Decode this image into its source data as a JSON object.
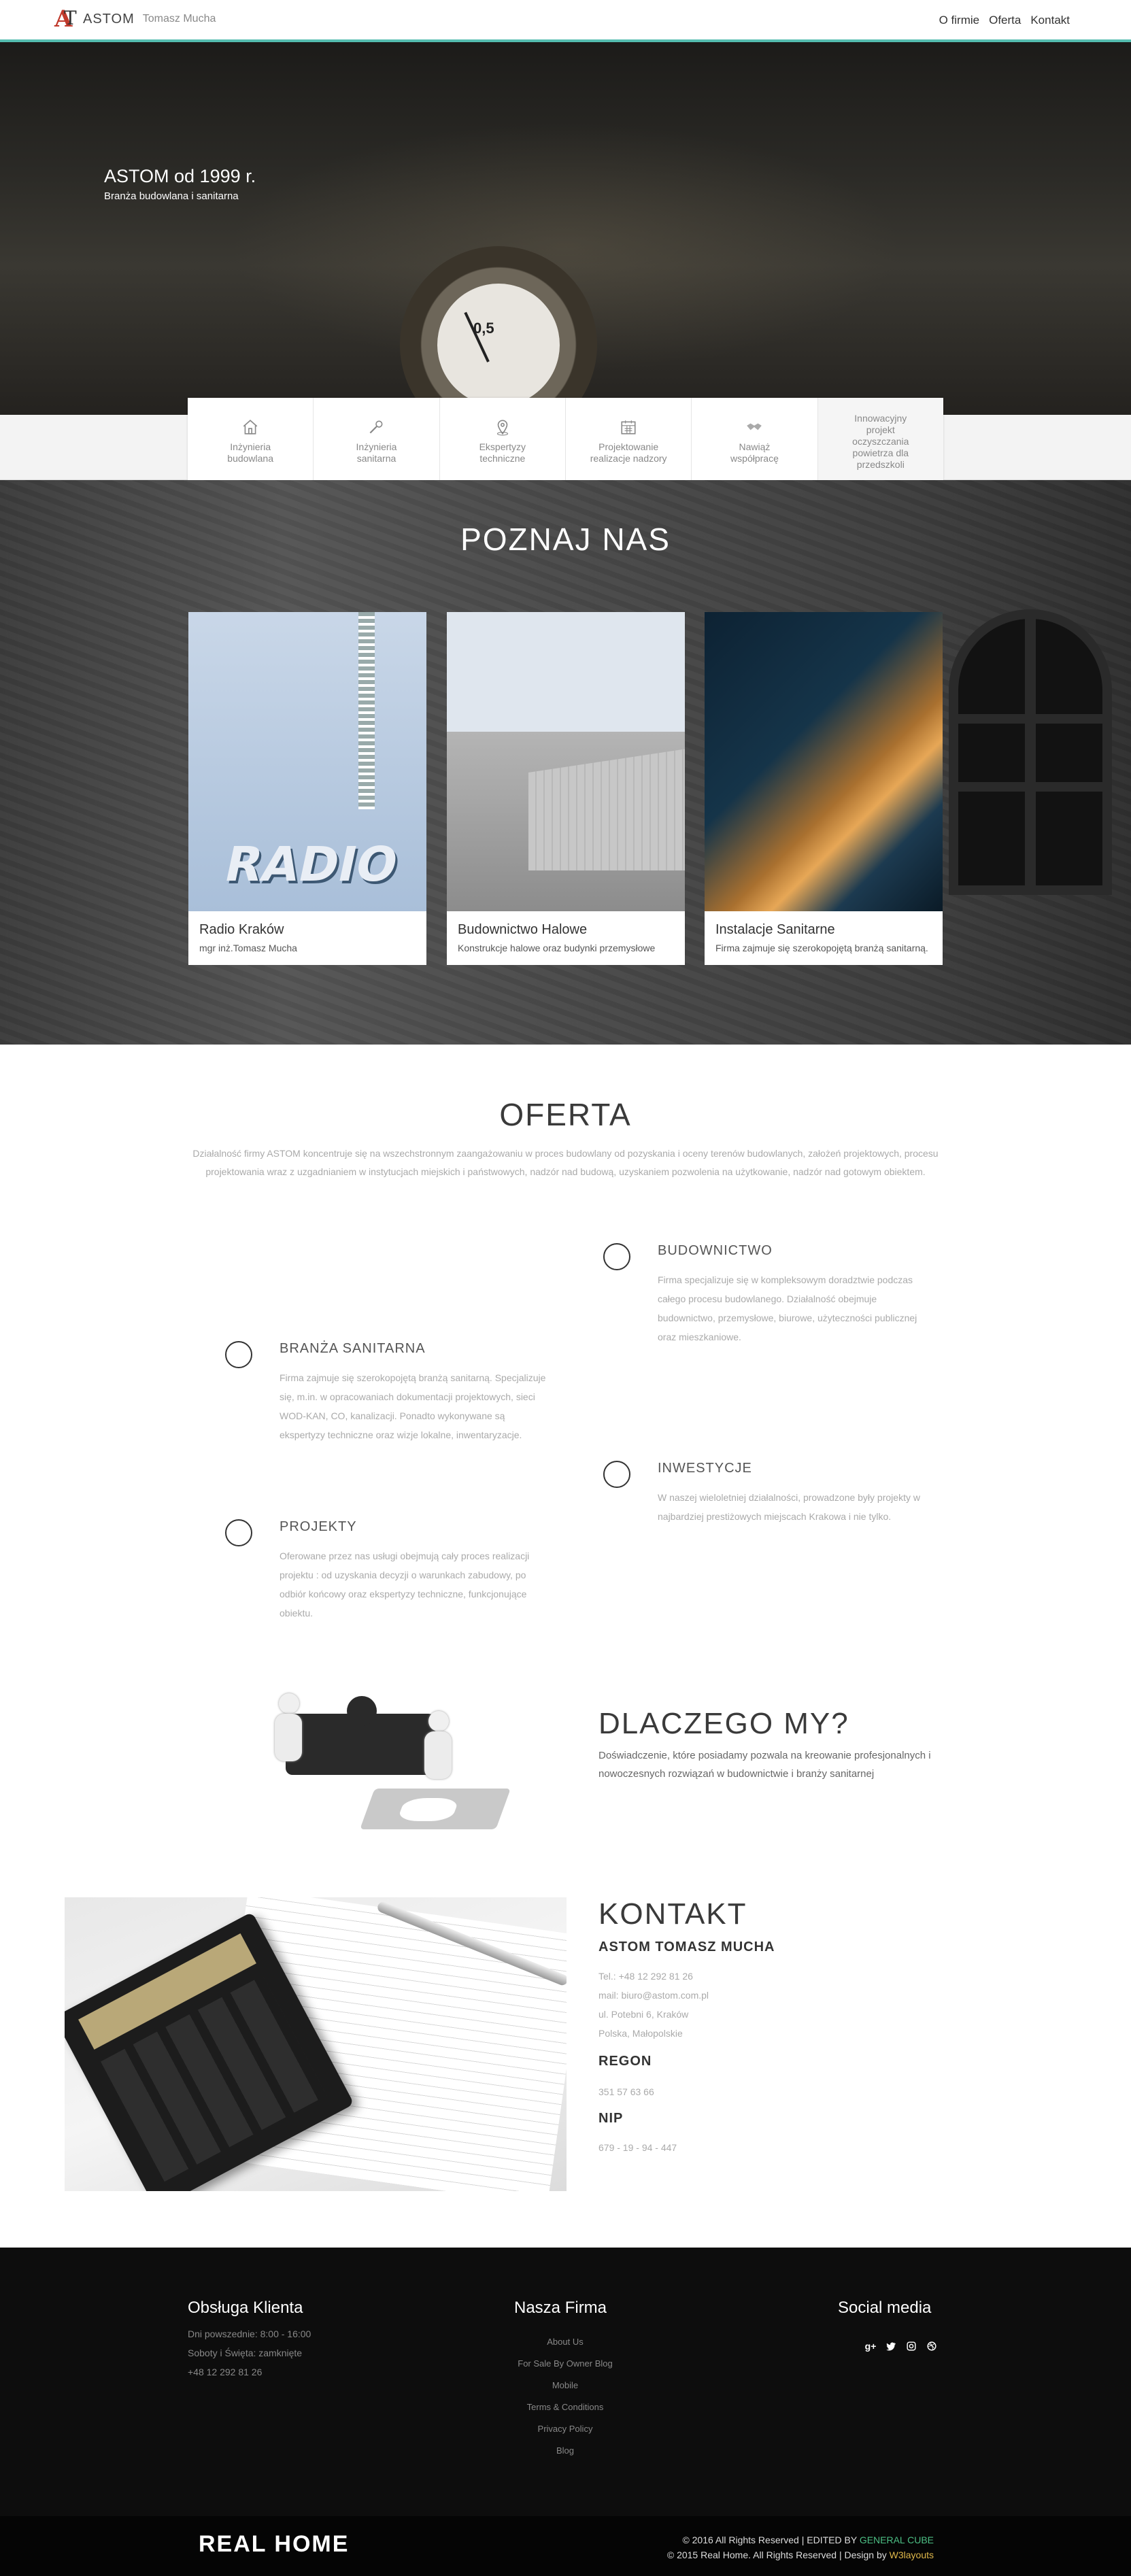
{
  "header": {
    "logo_name": "ASTOM",
    "logo_sub": "Tomasz Mucha",
    "nav": [
      "O firmie",
      "Oferta",
      "Kontakt"
    ]
  },
  "hero": {
    "title": "ASTOM od 1999 r.",
    "subtitle": "Branża budowlana i sanitarna",
    "gauge_value": "0,5"
  },
  "services": [
    {
      "label": "Inżynieria budowlana",
      "icon": "home-icon"
    },
    {
      "label": "Inżynieria sanitarna",
      "icon": "wrench-icon"
    },
    {
      "label": "Ekspertyzy techniczne",
      "icon": "location-pin-icon"
    },
    {
      "label": "Projektowanie realizacje nadzory",
      "icon": "calendar-icon"
    },
    {
      "label": "Nawiąż współpracę",
      "icon": "handshake-icon"
    },
    {
      "label": "Innowacyjny projekt oczyszczania powietrza dla przedszkoli",
      "icon": ""
    }
  ],
  "poznaj": {
    "title": "POZNAJ NAS",
    "cards": [
      {
        "title": "Radio Kraków",
        "desc": "mgr inż.Tomasz Mucha",
        "photo_text": "RADIO"
      },
      {
        "title": "Budownictwo Halowe",
        "desc": "Konstrukcje halowe oraz budynki przemysłowe"
      },
      {
        "title": "Instalacje Sanitarne",
        "desc": "Firma zajmuje się szerokopojętą branżą sanitarną."
      }
    ]
  },
  "oferta": {
    "title": "OFERTA",
    "intro": "Działalność firmy ASTOM koncentruje się na wszechstronnym zaangażowaniu w proces budowlany od pozyskania i oceny terenów budowlanych, założeń projektowych, procesu projektowania wraz z uzgadnianiem w instytucjach miejskich i państwowych, nadzór nad budową, uzyskaniem pozwolenia na użytkowanie, nadzór nad gotowym obiektem.",
    "items": [
      {
        "title": "BUDOWNICTWO",
        "text": "Firma specjalizuje się w kompleksowym doradztwie podczas całego procesu budowlanego. Działalność obejmuje budownictwo, przemysłowe, biurowe, użyteczności publicznej oraz mieszkaniowe."
      },
      {
        "title": "BRANŻA SANITARNA",
        "text": "Firma zajmuje się szerokopojętą branżą sanitarną. Specjalizuje się, m.in. w opracowaniach dokumentacji projektowych, sieci WOD-KAN, CO, kanalizacji. Ponadto wykonywane są ekspertyzy techniczne oraz wizje lokalne, inwentaryzacje."
      },
      {
        "title": "INWESTYCJE",
        "text": "W naszej wieloletniej działalności, prowadzone były projekty w najbardziej prestiżowych miejscach Krakowa i nie tylko."
      },
      {
        "title": "PROJEKTY",
        "text": "Oferowane przez nas usługi obejmują cały proces realizacji projektu : od uzyskania decyzji o warunkach zabudowy, po odbiór końcowy oraz ekspertyzy techniczne, funkcjonujące obiektu."
      }
    ]
  },
  "dlaczego": {
    "title": "DLACZEGO MY?",
    "text": "Doświadczenie, które posiadamy pozwala na kreowanie profesjonalnych i nowoczesnych rozwiązań w budownictwie i branży sanitarnej"
  },
  "kontakt": {
    "title": "KONTAKT",
    "company": "ASTOM TOMASZ MUCHA",
    "lines": [
      "Tel.: +48 12 292 81 26",
      "mail: biuro@astom.com.pl",
      "ul. Potebni 6, Kraków",
      "Polska, Małopolskie"
    ],
    "regon_label": "REGON",
    "regon": "351 57 63 66",
    "nip_label": "NIP",
    "nip": "679 - 19 - 94 - 447"
  },
  "footer": {
    "col1_title": "Obsługa Klienta",
    "col1_lines": [
      "Dni powszednie: 8:00 - 16:00",
      "Soboty i Święta: zamknięte",
      "+48 12 292 81 26"
    ],
    "col2_title": "Nasza Firma",
    "col2_links": [
      "About Us",
      "For Sale By Owner Blog",
      "Mobile",
      "Terms & Conditions",
      "Privacy Policy",
      "Blog"
    ],
    "col3_title": "Social media",
    "social_icons": [
      "g+",
      "twitter-icon",
      "instagram-icon",
      "dribbble-icon"
    ],
    "brand": "REAL HOME",
    "copy1_prefix": "© 2016 All Rights Reserved | EDITED BY",
    "copy1_link": "GENERAL CUBE",
    "copy2_prefix": "© 2015 Real Home. All Rights Reserved | Design by",
    "copy2_link": "W3layouts"
  }
}
